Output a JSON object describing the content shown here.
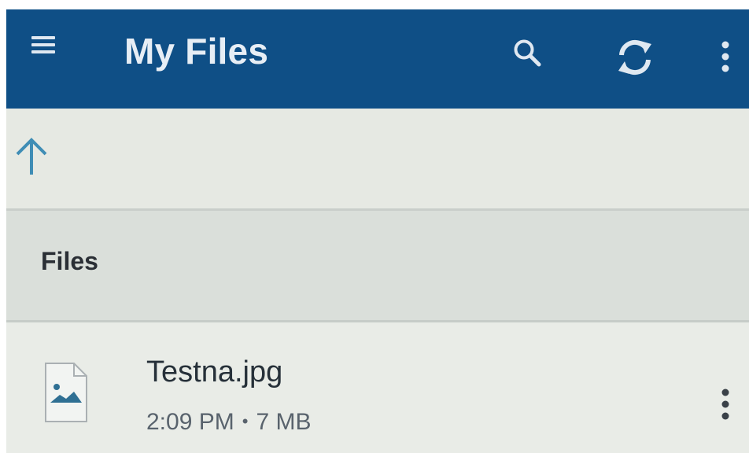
{
  "app_bar": {
    "title": "My Files",
    "background_color": "#0f4f86",
    "icons": [
      "menu-icon",
      "search-icon",
      "sync-icon",
      "more-vert-icon"
    ]
  },
  "navigation": {
    "up_icon": "arrow-up-icon",
    "accent_color": "#3f8db5"
  },
  "section": {
    "title": "Files"
  },
  "files": [
    {
      "name": "Testna.jpg",
      "time": "2:09 PM",
      "separator": "•",
      "size": "7 MB",
      "type_icon": "image-file-icon",
      "menu_icon": "more-vert-icon"
    }
  ]
}
